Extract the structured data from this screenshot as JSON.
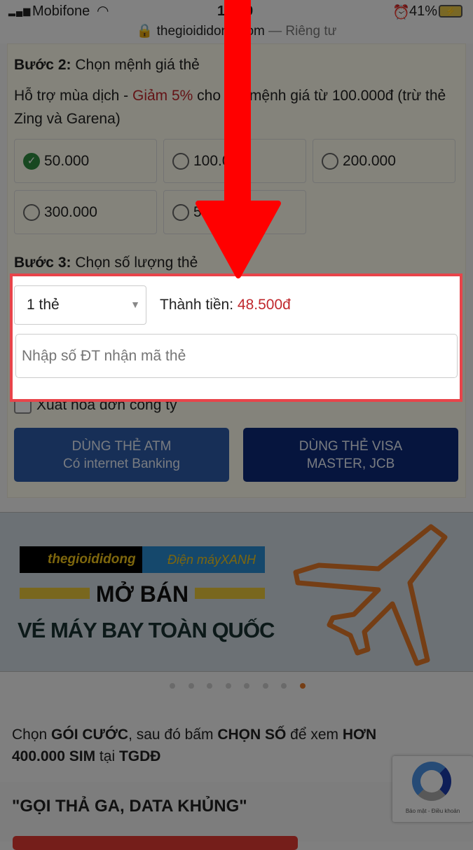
{
  "status_bar": {
    "carrier": "Mobifone",
    "time": "10:09",
    "battery": "41%",
    "url": "thegioididong.com",
    "privacy": "— Riêng tư"
  },
  "step2": {
    "label": "Bước 2:",
    "text": "Chọn mệnh giá thẻ",
    "promo_prefix": "Hỗ trợ mùa dịch - ",
    "promo_highlight": "Giảm 5%",
    "promo_suffix": " cho thẻ mệnh giá từ 100.000đ (trừ thẻ Zing và Garena)",
    "options": [
      {
        "value": "50.000",
        "selected": true
      },
      {
        "value": "100.000",
        "selected": false
      },
      {
        "value": "200.000",
        "selected": false
      },
      {
        "value": "300.000",
        "selected": false
      },
      {
        "value": "500.000",
        "selected": false
      }
    ]
  },
  "step3": {
    "label": "Bước 3:",
    "text": "Chọn số lượng thẻ",
    "quantity": "1 thẻ",
    "total_label": "Thành tiền: ",
    "total_value": "48.500đ",
    "phone_placeholder": "Nhập số ĐT nhận mã thẻ",
    "invoice_label": "Xuất hóa đơn công ty"
  },
  "buttons": {
    "atm_line1": "DÙNG THẺ ATM",
    "atm_line2": "Có internet Banking",
    "visa_line1": "DÙNG THẺ VISA",
    "visa_line2": "MASTER, JCB"
  },
  "banner": {
    "logo1": "thegioididong",
    "logo2": "Điện máyXANH",
    "headline": "MỞ BÁN",
    "subheadline": "VÉ MÁY BAY TOÀN QUỐC",
    "slides": 8,
    "active_slide": 8
  },
  "sim": {
    "t1": "Chọn ",
    "b1": "GÓI CƯỚC",
    "t2": ", sau đó bấm ",
    "b2": "CHỌN SỐ",
    "t3": " để xem ",
    "b3": "HƠN 400.000 SIM",
    "t4": " tại ",
    "b4": "TGDĐ"
  },
  "promo_title": "\"GỌI THẢ GA, DATA KHỦNG\"",
  "recaptcha": {
    "text": "Bảo mật - Điều khoản"
  },
  "colors": {
    "accent_red": "#c0282d",
    "highlight_border": "#e8444a",
    "arrow": "#ff0000",
    "atm_button": "#2c5aa8",
    "visa_button": "#0d2a78"
  }
}
